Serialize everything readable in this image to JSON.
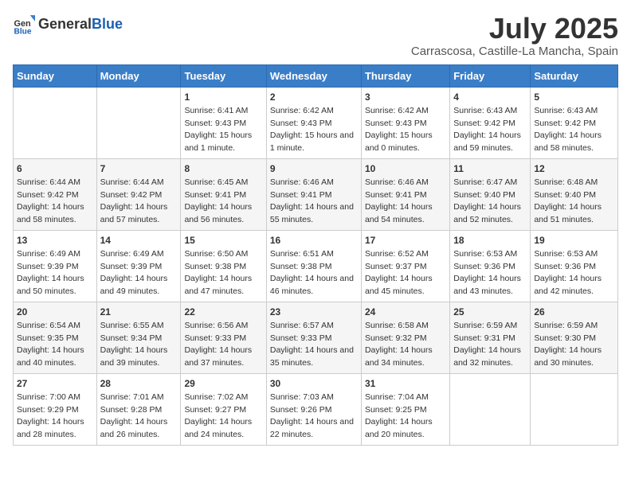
{
  "header": {
    "logo_general": "General",
    "logo_blue": "Blue",
    "title": "July 2025",
    "subtitle": "Carrascosa, Castille-La Mancha, Spain"
  },
  "days_of_week": [
    "Sunday",
    "Monday",
    "Tuesday",
    "Wednesday",
    "Thursday",
    "Friday",
    "Saturday"
  ],
  "weeks": [
    [
      {
        "day": "",
        "info": ""
      },
      {
        "day": "",
        "info": ""
      },
      {
        "day": "1",
        "info": "Sunrise: 6:41 AM\nSunset: 9:43 PM\nDaylight: 15 hours and 1 minute."
      },
      {
        "day": "2",
        "info": "Sunrise: 6:42 AM\nSunset: 9:43 PM\nDaylight: 15 hours and 1 minute."
      },
      {
        "day": "3",
        "info": "Sunrise: 6:42 AM\nSunset: 9:43 PM\nDaylight: 15 hours and 0 minutes."
      },
      {
        "day": "4",
        "info": "Sunrise: 6:43 AM\nSunset: 9:42 PM\nDaylight: 14 hours and 59 minutes."
      },
      {
        "day": "5",
        "info": "Sunrise: 6:43 AM\nSunset: 9:42 PM\nDaylight: 14 hours and 58 minutes."
      }
    ],
    [
      {
        "day": "6",
        "info": "Sunrise: 6:44 AM\nSunset: 9:42 PM\nDaylight: 14 hours and 58 minutes."
      },
      {
        "day": "7",
        "info": "Sunrise: 6:44 AM\nSunset: 9:42 PM\nDaylight: 14 hours and 57 minutes."
      },
      {
        "day": "8",
        "info": "Sunrise: 6:45 AM\nSunset: 9:41 PM\nDaylight: 14 hours and 56 minutes."
      },
      {
        "day": "9",
        "info": "Sunrise: 6:46 AM\nSunset: 9:41 PM\nDaylight: 14 hours and 55 minutes."
      },
      {
        "day": "10",
        "info": "Sunrise: 6:46 AM\nSunset: 9:41 PM\nDaylight: 14 hours and 54 minutes."
      },
      {
        "day": "11",
        "info": "Sunrise: 6:47 AM\nSunset: 9:40 PM\nDaylight: 14 hours and 52 minutes."
      },
      {
        "day": "12",
        "info": "Sunrise: 6:48 AM\nSunset: 9:40 PM\nDaylight: 14 hours and 51 minutes."
      }
    ],
    [
      {
        "day": "13",
        "info": "Sunrise: 6:49 AM\nSunset: 9:39 PM\nDaylight: 14 hours and 50 minutes."
      },
      {
        "day": "14",
        "info": "Sunrise: 6:49 AM\nSunset: 9:39 PM\nDaylight: 14 hours and 49 minutes."
      },
      {
        "day": "15",
        "info": "Sunrise: 6:50 AM\nSunset: 9:38 PM\nDaylight: 14 hours and 47 minutes."
      },
      {
        "day": "16",
        "info": "Sunrise: 6:51 AM\nSunset: 9:38 PM\nDaylight: 14 hours and 46 minutes."
      },
      {
        "day": "17",
        "info": "Sunrise: 6:52 AM\nSunset: 9:37 PM\nDaylight: 14 hours and 45 minutes."
      },
      {
        "day": "18",
        "info": "Sunrise: 6:53 AM\nSunset: 9:36 PM\nDaylight: 14 hours and 43 minutes."
      },
      {
        "day": "19",
        "info": "Sunrise: 6:53 AM\nSunset: 9:36 PM\nDaylight: 14 hours and 42 minutes."
      }
    ],
    [
      {
        "day": "20",
        "info": "Sunrise: 6:54 AM\nSunset: 9:35 PM\nDaylight: 14 hours and 40 minutes."
      },
      {
        "day": "21",
        "info": "Sunrise: 6:55 AM\nSunset: 9:34 PM\nDaylight: 14 hours and 39 minutes."
      },
      {
        "day": "22",
        "info": "Sunrise: 6:56 AM\nSunset: 9:33 PM\nDaylight: 14 hours and 37 minutes."
      },
      {
        "day": "23",
        "info": "Sunrise: 6:57 AM\nSunset: 9:33 PM\nDaylight: 14 hours and 35 minutes."
      },
      {
        "day": "24",
        "info": "Sunrise: 6:58 AM\nSunset: 9:32 PM\nDaylight: 14 hours and 34 minutes."
      },
      {
        "day": "25",
        "info": "Sunrise: 6:59 AM\nSunset: 9:31 PM\nDaylight: 14 hours and 32 minutes."
      },
      {
        "day": "26",
        "info": "Sunrise: 6:59 AM\nSunset: 9:30 PM\nDaylight: 14 hours and 30 minutes."
      }
    ],
    [
      {
        "day": "27",
        "info": "Sunrise: 7:00 AM\nSunset: 9:29 PM\nDaylight: 14 hours and 28 minutes."
      },
      {
        "day": "28",
        "info": "Sunrise: 7:01 AM\nSunset: 9:28 PM\nDaylight: 14 hours and 26 minutes."
      },
      {
        "day": "29",
        "info": "Sunrise: 7:02 AM\nSunset: 9:27 PM\nDaylight: 14 hours and 24 minutes."
      },
      {
        "day": "30",
        "info": "Sunrise: 7:03 AM\nSunset: 9:26 PM\nDaylight: 14 hours and 22 minutes."
      },
      {
        "day": "31",
        "info": "Sunrise: 7:04 AM\nSunset: 9:25 PM\nDaylight: 14 hours and 20 minutes."
      },
      {
        "day": "",
        "info": ""
      },
      {
        "day": "",
        "info": ""
      }
    ]
  ]
}
